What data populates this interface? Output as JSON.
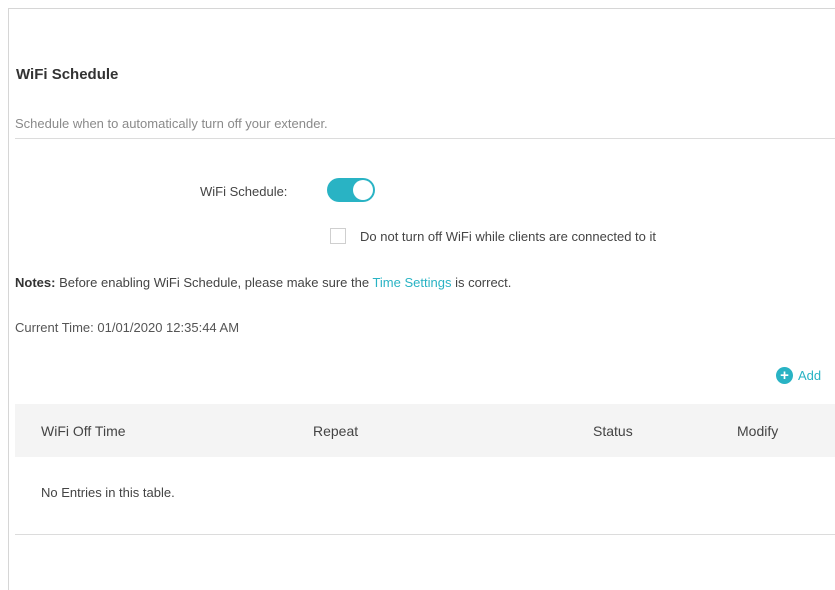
{
  "page": {
    "title": "WiFi Schedule",
    "subtitle": "Schedule when to automatically turn off your extender."
  },
  "schedule": {
    "label": "WiFi Schedule:",
    "enabled": true,
    "checkbox_label": "Do not turn off WiFi while clients are connected to it",
    "checkbox_checked": false
  },
  "notes": {
    "prefix": "Notes:",
    "text_before": " Before enabling WiFi Schedule, please make sure the ",
    "link": "Time Settings",
    "text_after": " is correct."
  },
  "current_time": {
    "label": "Current Time:",
    "value": "01/01/2020 12:35:44 AM"
  },
  "add_button": {
    "icon": "plus-circle-icon",
    "label": "Add"
  },
  "table": {
    "columns": [
      "WiFi Off Time",
      "Repeat",
      "Status",
      "Modify"
    ],
    "empty_text": "No Entries in this table."
  },
  "colors": {
    "accent": "#29b3c4"
  }
}
